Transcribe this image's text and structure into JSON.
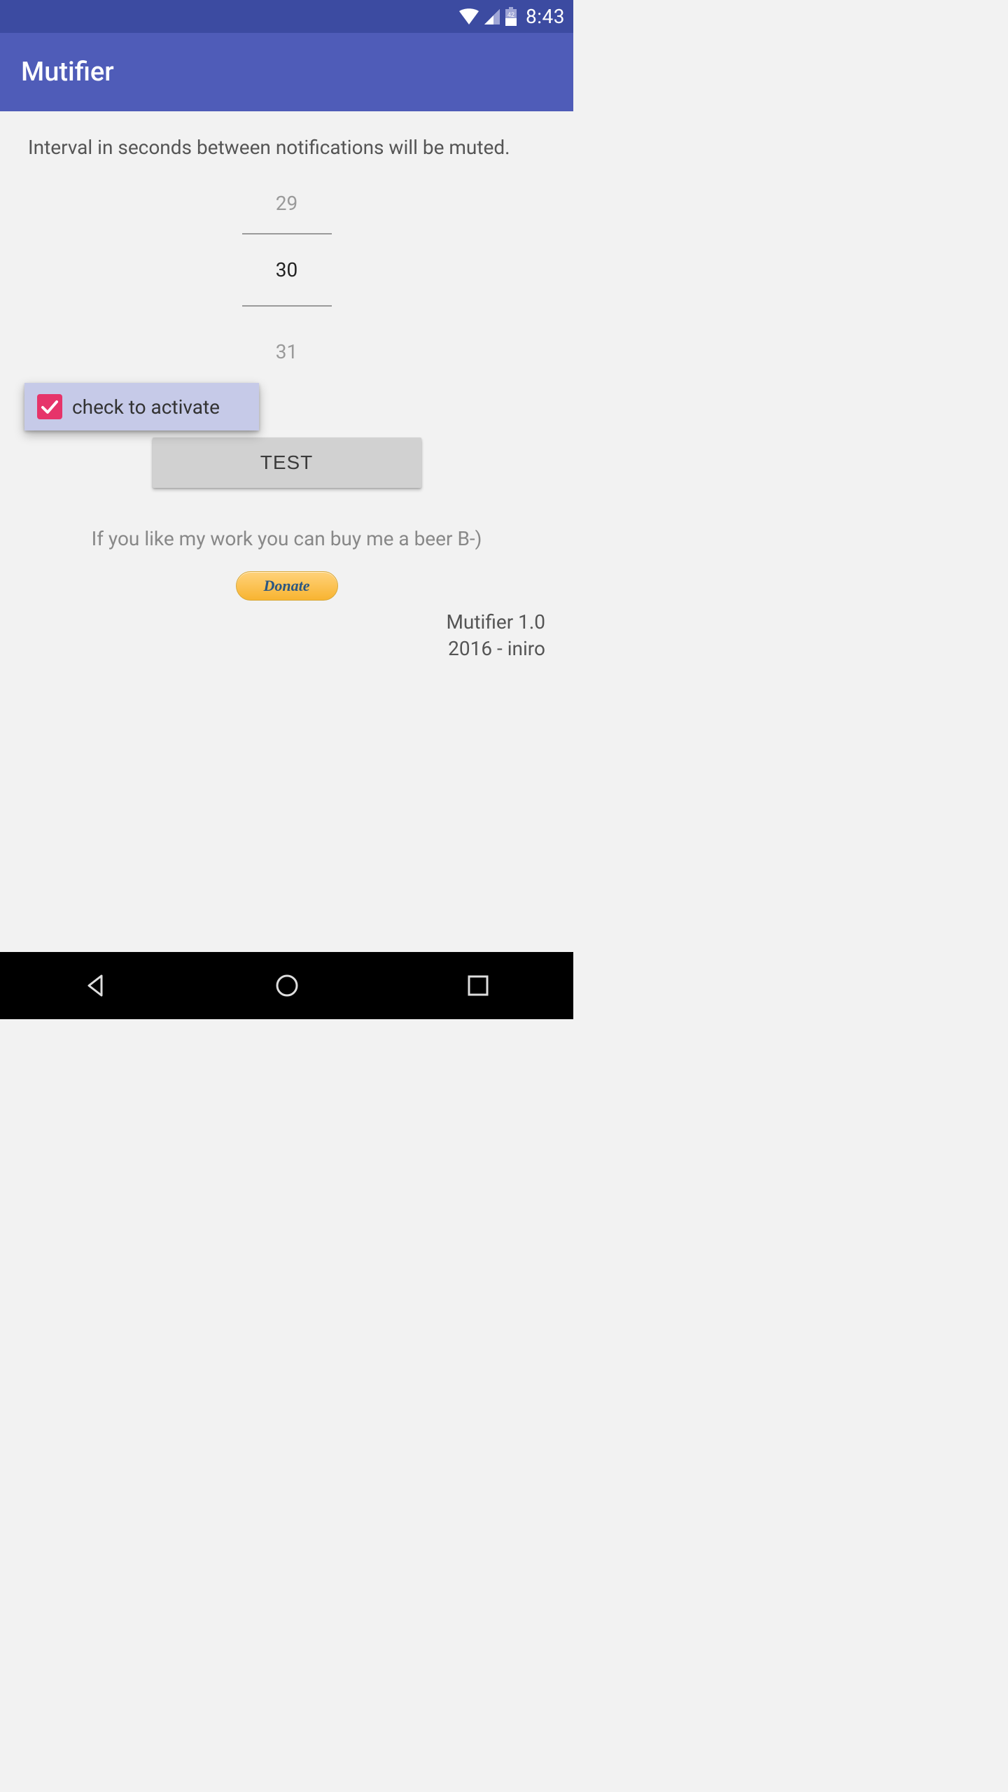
{
  "status_bar": {
    "time": "8:43",
    "battery_level": "42"
  },
  "app_bar": {
    "title": "Mutifier"
  },
  "main": {
    "description": "Interval in seconds between notifications will be muted.",
    "picker": {
      "prev": "29",
      "current": "30",
      "next": "31"
    },
    "activate": {
      "checked": true,
      "label": "check to activate"
    },
    "test_button": "TEST",
    "like_text": "If you like my work you can buy me a beer B-)",
    "donate_label": "Donate",
    "credits_line1": "Mutifier 1.0",
    "credits_line2": "2016 - iniro"
  }
}
